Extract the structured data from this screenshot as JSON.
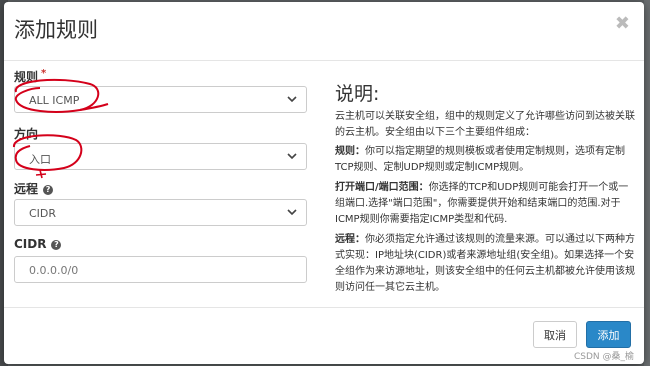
{
  "dialog": {
    "title": "添加规则",
    "close_icon": "close-icon"
  },
  "form": {
    "rule": {
      "label": "规则",
      "required_mark": "*",
      "value": "ALL ICMP"
    },
    "direction": {
      "label": "方向",
      "value": "入口"
    },
    "remote": {
      "label": "远程",
      "help_icon": "?",
      "value": "CIDR"
    },
    "cidr": {
      "label": "CIDR",
      "help_icon": "?",
      "value": "0.0.0.0/0"
    }
  },
  "help": {
    "title": "说明:",
    "intro": "云主机可以关联安全组，组中的规则定义了允许哪些访问到达被关联的云主机。安全组由以下三个主要组件组成：",
    "rule_term": "规则：",
    "rule_desc": "你可以指定期望的规则模板或者使用定制规则，选项有定制TCP规则、定制UDP规则或定制ICMP规则。",
    "port_term": "打开端口/端口范围：",
    "port_desc": "你选择的TCP和UDP规则可能会打开一个或一组端口.选择\"端口范围\"，你需要提供开始和结束端口的范围.对于ICMP规则你需要指定ICMP类型和代码.",
    "remote_term": "远程：",
    "remote_desc": "你必须指定允许通过该规则的流量来源。可以通过以下两种方式实现：IP地址块(CIDR)或者来源地址组(安全组)。如果选择一个安全组作为来访源地址，则该安全组中的任何云主机都被允许使用该规则访问任一其它云主机。"
  },
  "footer": {
    "cancel_label": "取消",
    "submit_label": "添加"
  },
  "watermark": "CSDN @桑_榆",
  "colors": {
    "primary": "#2a88c8",
    "annotation": "#d4001a"
  }
}
